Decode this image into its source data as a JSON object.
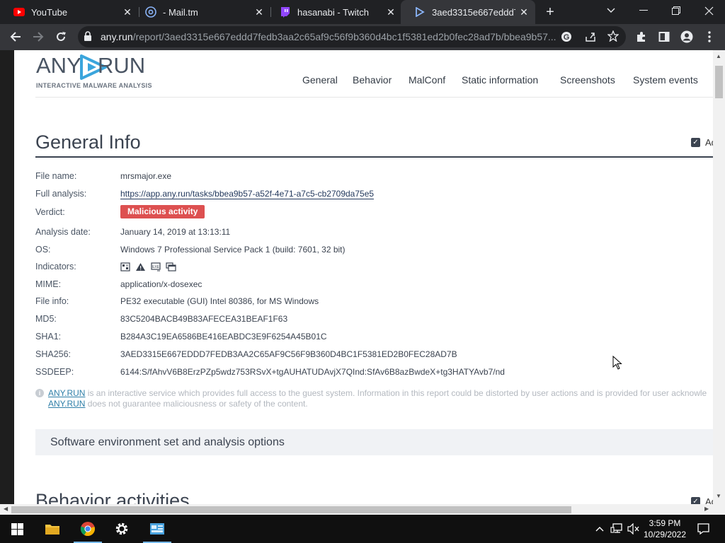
{
  "browser": {
    "tabs": [
      {
        "title": "YouTube",
        "icon": "youtube-icon"
      },
      {
        "title": "- Mail.tm",
        "icon": "mailtm-icon"
      },
      {
        "title": "hasanabi - Twitch",
        "icon": "twitch-icon"
      },
      {
        "title": "3aed3315e667eddd7fe",
        "icon": "anyrun-icon",
        "active": true
      }
    ],
    "url_host": "any.run",
    "url_path": "/report/3aed3315e667eddd7fedb3aa2c65af9c56f9b360d4bc1f5381ed2b0fec28ad7b/bbea9b57..."
  },
  "site": {
    "logo_left": "ANY",
    "logo_right": "RUN",
    "tagline": "INTERACTIVE MALWARE ANALYSIS",
    "nav": [
      "General",
      "Behavior",
      "MalConf",
      "Static information",
      "Screenshots",
      "System events"
    ]
  },
  "general": {
    "heading": "General Info",
    "checkbox_label": "Ad",
    "rows": [
      {
        "label": "File name:",
        "value": "mrsmajor.exe"
      },
      {
        "label": "Full analysis:",
        "value": "https://app.any.run/tasks/bbea9b57-a52f-4e71-a7c5-cb2709da75e5"
      },
      {
        "label": "Verdict:",
        "value": "Malicious activity"
      },
      {
        "label": "Analysis date:",
        "value": "January 14, 2019 at 13:13:11"
      },
      {
        "label": "OS:",
        "value": "Windows 7 Professional Service Pack 1 (build: 7601, 32 bit)"
      },
      {
        "label": "Indicators:",
        "value": ""
      },
      {
        "label": "MIME:",
        "value": "application/x-dosexec"
      },
      {
        "label": "File info:",
        "value": "PE32 executable (GUI) Intel 80386, for MS Windows"
      },
      {
        "label": "MD5:",
        "value": "83C5204BACB49B83AFECEA31BEAF1F63"
      },
      {
        "label": "SHA1:",
        "value": "B284A3C19EA6586BE416EABDC3E9F6254A45B01C"
      },
      {
        "label": "SHA256:",
        "value": "3AED3315E667EDDD7FEDB3AA2C65AF9C56F9B360D4BC1F5381ED2B0FEC28AD7B"
      },
      {
        "label": "SSDEEP:",
        "value": "6144:S/fAhvV6B8ErzPZp5wdz753RSvX+tgAUHATUDAvjX7QInd:SfAv6B8azBwdeX+tg3HATYAvb7/nd"
      }
    ],
    "note_link": "ANY.RUN",
    "note_line1": " is an interactive service which provides full access to the guest system. Information in this report could be distorted by user actions and is provided for user acknowle",
    "note_line2": " does not guarantee maliciousness or safety of the content."
  },
  "software_box": "Software environment set and analysis options",
  "behavior": {
    "heading": "Behavior activities",
    "checkbox_label": "Ad"
  },
  "taskbar": {
    "time": "3:59 PM",
    "date": "10/29/2022"
  },
  "colors": {
    "verdict_red": "#dd5050",
    "accent_dark": "#3b4350"
  }
}
